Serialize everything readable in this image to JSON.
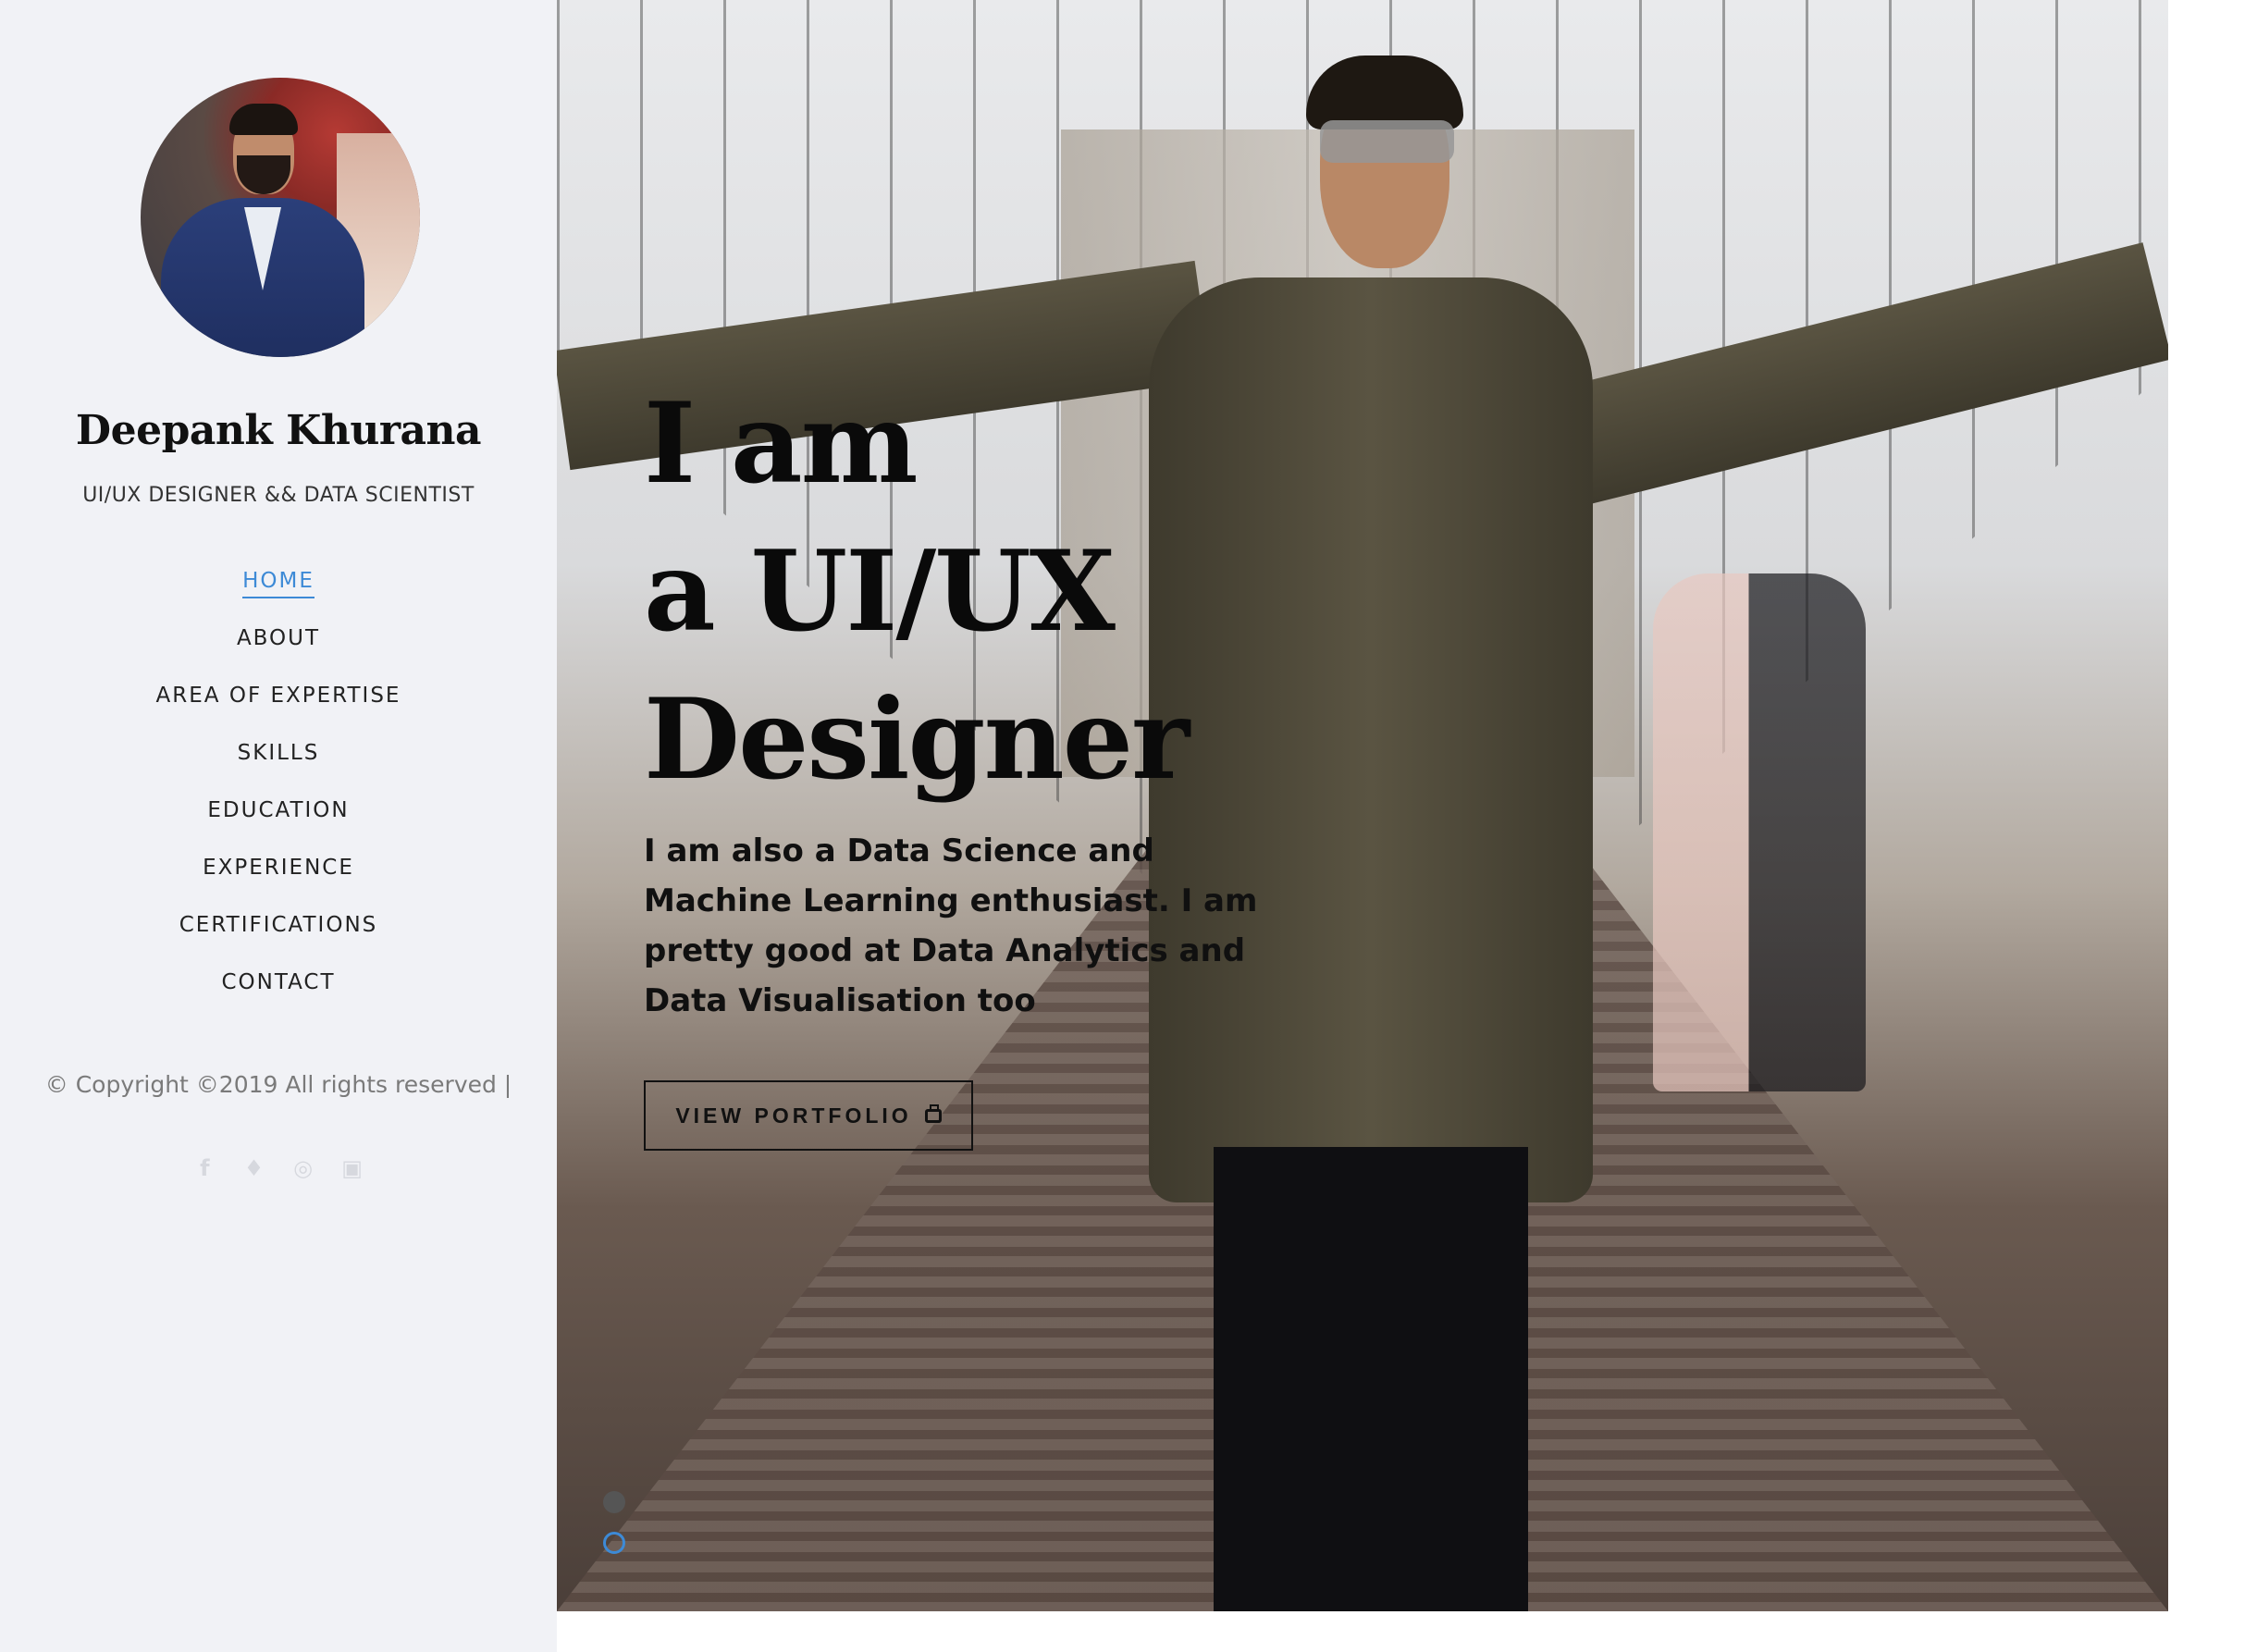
{
  "sidebar": {
    "name": "Deepank Khurana",
    "role": "UI/UX DESIGNER && DATA SCIENTIST",
    "nav": [
      {
        "label": "HOME",
        "active": true
      },
      {
        "label": "ABOUT"
      },
      {
        "label": "AREA OF EXPERTISE"
      },
      {
        "label": "SKILLS"
      },
      {
        "label": "EDUCATION"
      },
      {
        "label": "EXPERIENCE"
      },
      {
        "label": "CERTIFICATIONS"
      },
      {
        "label": "CONTACT"
      }
    ],
    "copyright": "© Copyright ©2019 All rights reserved |",
    "socials": [
      "facebook-icon",
      "twitter-icon",
      "instagram-icon",
      "linkedin-icon"
    ]
  },
  "hero": {
    "title_line1": "I am",
    "title_line2": "a UI/UX",
    "title_line3": "Designer",
    "description": "I am also a Data Science and Machine Learning enthusiast. I am pretty good at Data Analytics and Data Visualisation too",
    "button_label": "VIEW PORTFOLIO",
    "slides_total": 2,
    "slide_active": 2
  },
  "colors": {
    "accent": "#3d8ad6",
    "sidebar_bg": "#f1f2f6",
    "text_dark": "#111111"
  }
}
